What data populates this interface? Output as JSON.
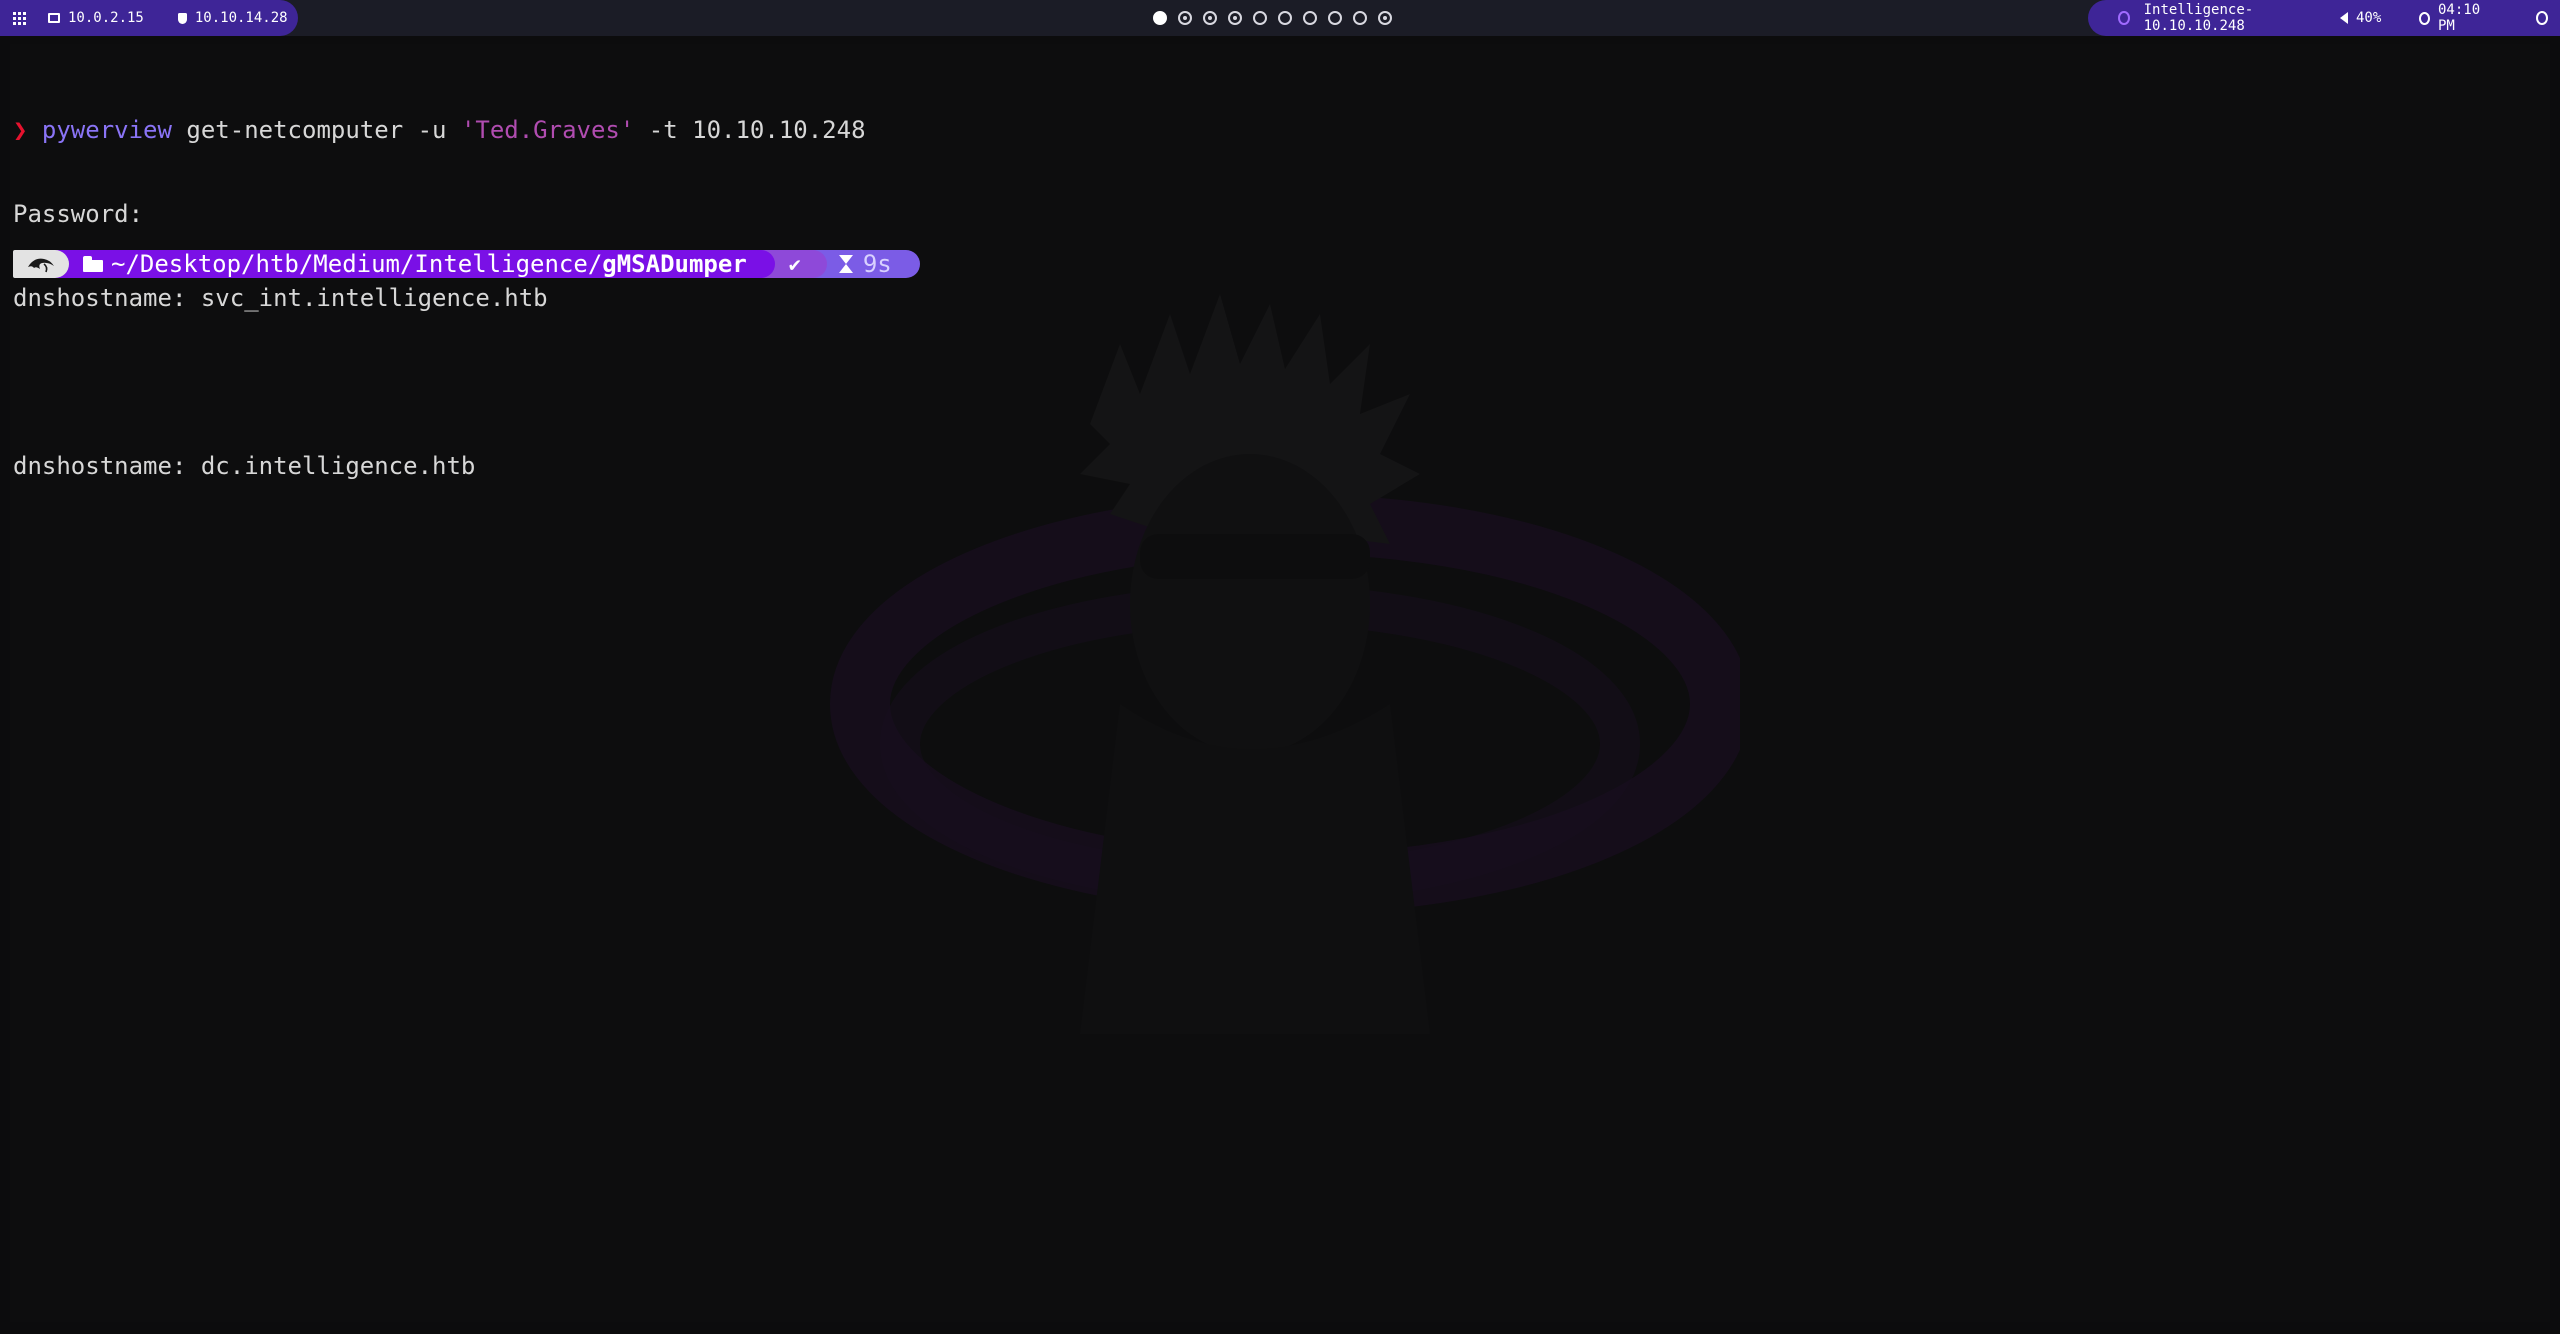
{
  "topbar": {
    "left": {
      "local_ip": "10.0.2.15",
      "vpn_ip": "10.10.14.28"
    },
    "workspaces": [
      {
        "state": "active"
      },
      {
        "state": "occupied"
      },
      {
        "state": "occupied"
      },
      {
        "state": "occupied"
      },
      {
        "state": "empty"
      },
      {
        "state": "empty"
      },
      {
        "state": "empty"
      },
      {
        "state": "empty"
      },
      {
        "state": "empty"
      },
      {
        "state": "occupied"
      }
    ],
    "right": {
      "target": "Intelligence-10.10.10.248",
      "volume": "40%",
      "clock": "04:10 PM"
    }
  },
  "terminal": {
    "command": {
      "prompt_symbol": "❯",
      "program": "pywerview",
      "args_before": " get-netcomputer -u ",
      "quoted_arg": "'Ted.Graves'",
      "args_after": " -t 10.10.10.248"
    },
    "output": [
      "Password:",
      "dnshostname: svc_int.intelligence.htb",
      "",
      "dnshostname: dc.intelligence.htb"
    ],
    "powerline": {
      "cwd_base": "~/Desktop/htb/Medium/Intelligence/",
      "cwd_last": "gMSADumper",
      "status": "✔",
      "duration": "9s"
    }
  },
  "colors": {
    "bar_accent": "#3e2597",
    "path_segment": "#7a10e6",
    "status_segment": "#8e49d9",
    "time_segment": "#7b5ce6",
    "prompt_arrow": "#e5122e",
    "command_name": "#8a74f6",
    "string_arg": "#b04cb0"
  }
}
